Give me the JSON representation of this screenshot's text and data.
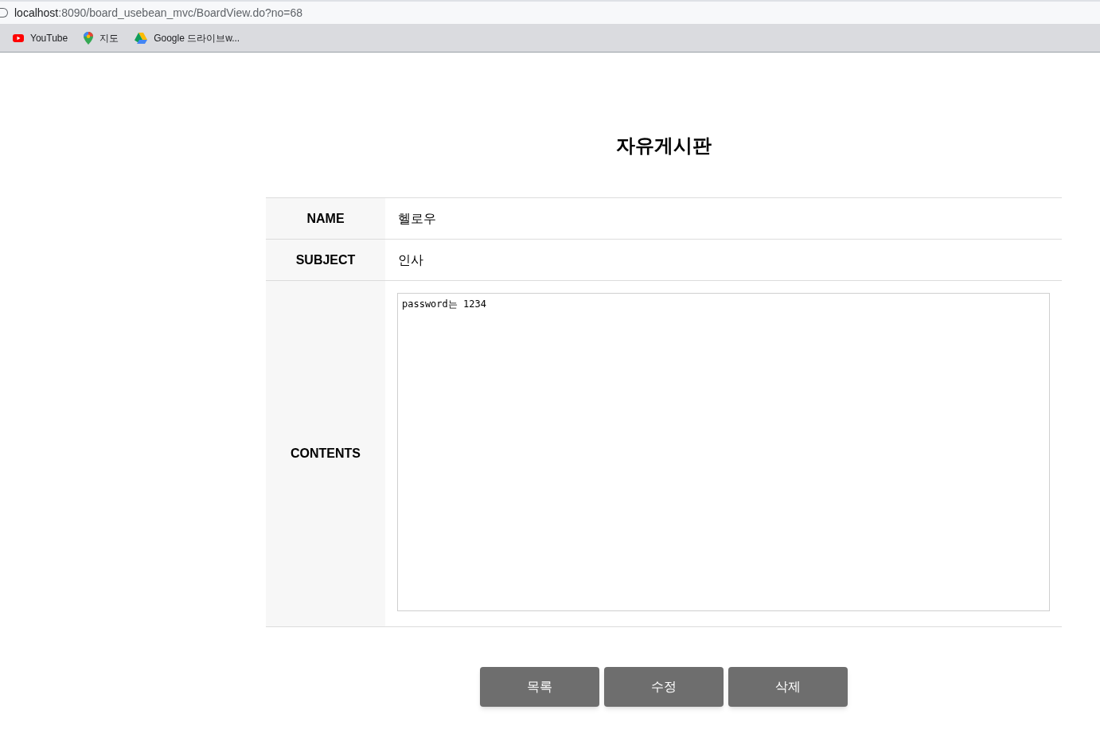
{
  "browser": {
    "url_host": "localhost",
    "url_path": ":8090/board_usebean_mvc/BoardView.do?no=68",
    "bookmarks": [
      {
        "kind": "youtube",
        "label": "YouTube"
      },
      {
        "kind": "maps",
        "label": "지도"
      },
      {
        "kind": "drive",
        "label": "Google 드라이브w..."
      }
    ]
  },
  "page": {
    "title": "자유게시판",
    "fields": [
      {
        "label": "NAME",
        "value": "헬로우"
      },
      {
        "label": "SUBJECT",
        "value": "인사"
      }
    ],
    "contents": {
      "label": "CONTENTS",
      "value": "password는 1234"
    },
    "buttons": [
      "목록",
      "수정",
      "삭제"
    ]
  }
}
